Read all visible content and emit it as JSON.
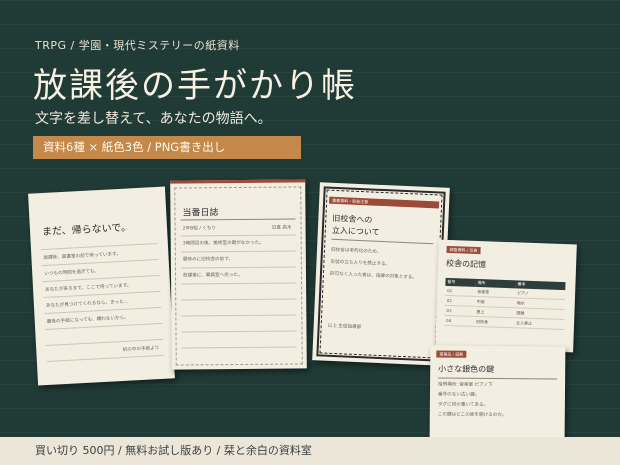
{
  "header": {
    "category_line": "TRPG / 学園・現代ミステリーの紙資料",
    "title": "放課後の手がかり帳",
    "subtitle": "文字を差し替えて、あなたの物語へ。",
    "feature_bar": "資料6種 × 紙色3色 / PNG書き出し"
  },
  "footer": {
    "text": "買い切り 500円 / 無料お試し版あり / 栞と余白の資料室"
  },
  "colors": {
    "background": "#203a35",
    "accent": "#c4894a",
    "paper": "#f3eee2",
    "badge": "#9c4a3a",
    "footer_bg": "#ece6d8"
  },
  "cards": {
    "letter": {
      "title": "まだ、帰らないで。",
      "lines": [
        "放課後、図書室の前で待っています。",
        "いつもの時間を過ぎても、",
        "あなたが来るまで、ここで待っています。",
        "あなたが見つけてくれるなら、きっと…",
        "最後の手紙になっても、構わないから。"
      ],
      "signature": "机の中の手紙より"
    },
    "diary": {
      "title": "当番日誌",
      "meta_left": "2年B組 / くもり",
      "meta_right": "日直 高木",
      "lines": [
        "3時間目の後、美術室の鍵がなかった。",
        "昼休みに旧校舎の前で、",
        "放課後に、職員室へ戻った。"
      ]
    },
    "document": {
      "badge": "重要資料・取扱注意",
      "title_line1": "旧校舎への",
      "title_line2": "立入について",
      "lines": [
        "旧校舎は老朽化のため、",
        "生徒の立ち入りを禁止する。",
        "許可なく入った者は、指導の対象とする。"
      ],
      "footer": "以上 生徒指導部"
    },
    "memory": {
      "badge": "調査資料 / 写真",
      "title": "校舎の記憶",
      "columns": [
        "番号",
        "場所",
        "備考"
      ],
      "rows": [
        [
          "01",
          "音楽室",
          "ピアノ"
        ],
        [
          "02",
          "中庭",
          "噴水"
        ],
        [
          "03",
          "屋上",
          "閉鎖"
        ],
        [
          "04",
          "旧校舎",
          "立入禁止"
        ]
      ]
    },
    "key": {
      "badge": "遺留品 / 証拠",
      "title": "小さな銀色の鍵",
      "lines": [
        "拾得場所: 音楽室 ピアノ下",
        "番号のない古い鍵。",
        "タグに何か書いてある。",
        "この鍵はどこの扉を開けるのか。"
      ]
    }
  }
}
